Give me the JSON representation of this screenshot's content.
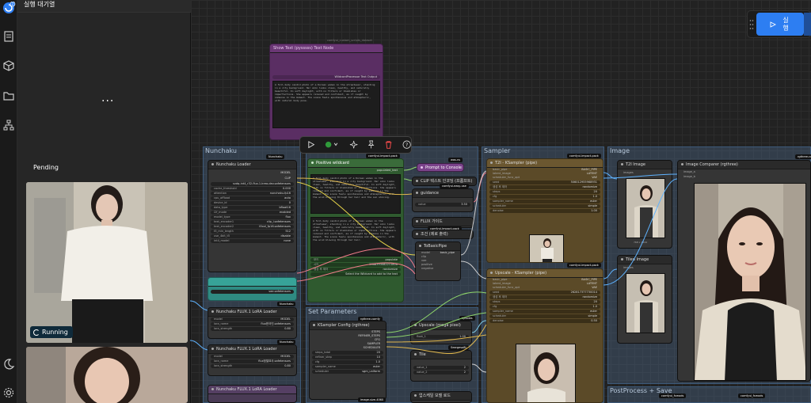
{
  "queue": {
    "title": "실행 대기열",
    "dots": "...",
    "pending_label": "Pending",
    "running_label": "Running"
  },
  "toolbar": {
    "icons": [
      "play-icon",
      "color-picker-icon",
      "sparkle-icon",
      "pin-icon",
      "trash-icon",
      "help-icon"
    ]
  },
  "run_button": {
    "label": "실행"
  },
  "groups": {
    "nunchaku": "Nunchaku",
    "sampler": "Sampler",
    "image": "Image",
    "set_parameters": "Set Parameters",
    "postprocess": "PostProcess + Save"
  },
  "nodes": {
    "loader": {
      "title": "Nunchaku Loader",
      "out_model": "MODEL",
      "out_clip": "CLIP",
      "rows": [
        [
          "",
          "svdq-int4_r32-flux.1-krea-dev.safetensors"
        ],
        [
          "cache_threshold",
          "0.000"
        ],
        [
          "attention",
          "nunchaku-fp16"
        ],
        [
          "cpu_offload",
          "auto"
        ],
        [
          "device_id",
          "0"
        ],
        [
          "data_type",
          "bfloat16"
        ],
        [
          "i2f_mode",
          "enabled"
        ],
        [
          "model_type",
          "flux"
        ],
        [
          "text_encoder1",
          "clip_l.safetensors"
        ],
        [
          "text_encoder2",
          "t5xxl_fp16.safetensors"
        ],
        [
          "t5_min_length",
          "512"
        ],
        [
          "use_4bit_t5",
          "disable"
        ],
        [
          "int4_model",
          "none"
        ]
      ],
      "pack": "Nunchaku"
    },
    "lora1": {
      "title": "Nunchaku FLUX.1 LoRA Loader",
      "rows": [
        [
          "model",
          "MODEL"
        ],
        [
          "lora_name",
          "flux한국인.safetensors"
        ],
        [
          "lora_strength",
          "0.80"
        ]
      ]
    },
    "lora2": {
      "title": "Nunchaku FLUX.1 LoRA Loader",
      "rows": [
        [
          "model",
          "MODEL"
        ],
        [
          "lora_name",
          "flux정밀묘사.safetensors"
        ],
        [
          "lora_strength",
          "0.80"
        ]
      ]
    },
    "lora3": {
      "title": "Nunchaku FLUX.1 LoRA Loader"
    },
    "wildcard": {
      "title": "Positive wildcard",
      "pack": "comfyui-impact-pack",
      "text1": "A full-body candid photo of a Korean woman in the streetwear, standing in a city background. Her skin looks clean, healthy, and naturally beautiful. In soft daylight, with no filters or blemishes or imperfections. She appears relaxed and confident, as if caught by someone in the moment. The scene feels spontaneous and atmospheric, with the wind blowing through her hair and the sun shining.",
      "text2": "A full-body candid photo of a Korean woman in the streetwear, standing in a city background. Her skin looks clean, healthy, and naturally beautiful. In soft daylight, with no filters or blemishes or imperfections. She appears relaxed and confident, as if caught by someone in the moment. The scene feels spontaneous and atmospheric, with the wind blowing through her hair.",
      "rows": [
        [
          "모드",
          "populate"
        ],
        [
          "시드",
          "2068393082211806"
        ],
        [
          "생성 후 제어",
          "randomize"
        ],
        [
          "",
          "Select the Wildcard to add to the text"
        ]
      ],
      "populated_text": "populated_text"
    },
    "prompt_console": {
      "title": "Prompt to Console",
      "pack": "was-ns"
    },
    "clip_encode": {
      "title": "CLIP 텍스트 인코딩 (프롬프트)",
      "pack": "comfyui-easy-use"
    },
    "guidance": {
      "title": "guidance",
      "rows": [
        [
          "value",
          "3.50"
        ]
      ]
    },
    "flux_guide": {
      "title": "FLUX 가이드",
      "pack": "comfyui-impact-pack",
      "rows": [
        [
          "guidance",
          "3.5"
        ]
      ]
    },
    "condition": {
      "title": "조건 (제로 출력)"
    },
    "tobasic": {
      "title": "ToBasicPipe",
      "out": "basic_pipe",
      "inputs": [
        "model",
        "clip",
        "vae",
        "positive",
        "negative"
      ]
    },
    "ksampler": {
      "title": "T2I - KSampler (pipe)",
      "pack": "comfyui-impact-pack",
      "outputs": [
        "BASIC_PIPE",
        "LATENT",
        "VAE"
      ],
      "inputs": [
        "basic_pipe",
        "latent_image",
        "scheduler_func_opt"
      ],
      "rows": [
        [
          "seed",
          "506012955968931"
        ],
        [
          "생성 후 제어",
          "randomize"
        ],
        [
          "steps",
          "20"
        ],
        [
          "cfg",
          "1.0"
        ],
        [
          "sampler_name",
          "euler"
        ],
        [
          "scheduler",
          "simple"
        ],
        [
          "denoise",
          "1.00"
        ]
      ]
    },
    "upscale": {
      "title": "Upscale - KSampler (pipe)",
      "pack": "comfyui-impact-pack",
      "outputs": [
        "BASIC_PIPE",
        "LATENT",
        "VAE"
      ],
      "inputs": [
        "basic_pipe",
        "latent_image",
        "scheduler_func_opt"
      ],
      "rows": [
        [
          "seed",
          "262817377730014"
        ],
        [
          "생성 후 제어",
          "randomize"
        ],
        [
          "steps",
          "20"
        ],
        [
          "cfg",
          "1.0"
        ],
        [
          "sampler_name",
          "euler"
        ],
        [
          "scheduler",
          "simple"
        ],
        [
          "denoise",
          "0.50"
        ]
      ]
    },
    "t2i_image": {
      "title": "T2I Image",
      "input": "images",
      "size": "768 x 1344"
    },
    "tiled_image": {
      "title": "Tiled Image",
      "input": "images"
    },
    "image_compare": {
      "title": "Image Comparer (rgthree)",
      "inputs": [
        "image_a",
        "image_b"
      ],
      "pack": "rgthree-comfy"
    },
    "ksampler_config": {
      "title": "KSampler Config (rgthree)",
      "pack": "rgthree-comfy",
      "outputs": [
        "STEPS",
        "REFINER_STEPS",
        "CFG",
        "SAMPLER",
        "SCHEDULER"
      ],
      "rows": [
        [
          "steps_total",
          "20"
        ],
        [
          "refiner_step",
          "10"
        ],
        [
          "cfg",
          "1.0"
        ],
        [
          "sampler_name",
          "euler"
        ],
        [
          "scheduler",
          "sgm_uniform"
        ]
      ],
      "pack2": "image-size-4060"
    },
    "upscale_mega": {
      "title": "Upscale (mega pixel)",
      "rows": [
        [
          "float_1",
          "1.00"
        ]
      ],
      "pack": "kjnodes"
    },
    "tile": {
      "title": "Tile",
      "rows": [
        [
          "value_1",
          "2"
        ],
        [
          "value_2",
          "2"
        ]
      ],
      "pack": "Seargeso8L"
    },
    "upscale_model": {
      "title": "업스케일 모델 로드"
    },
    "save": {
      "pack": "comfyui_fsmods"
    },
    "pack_left": "comfyui_wildcards"
  },
  "top_node": {
    "title": "Show Text (pysssss) Text Node",
    "pack": "comfyui_custom_scripts_dataset",
    "inner": "WildcardProcessor Text Output",
    "text": "A full-body candid photo of a Korean woman in the streetwear, standing in a city background. Her skin looks clean, healthy, and naturally beautiful. In soft daylight, with no filters or blemishes or imperfections. She appears relaxed and confident, as if caught by someone in the moment. The scene feels spontaneous and atmospheric, with natural body pose."
  }
}
